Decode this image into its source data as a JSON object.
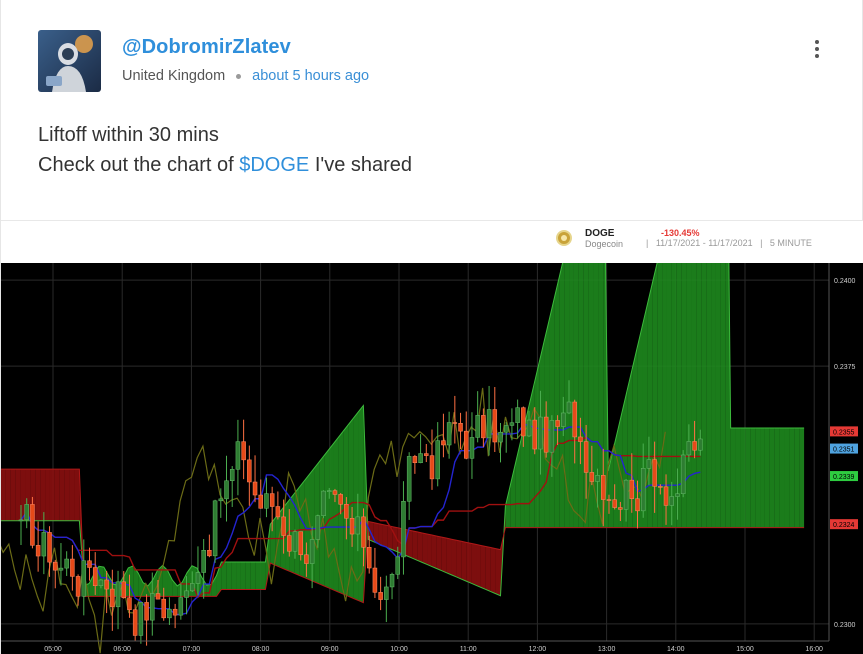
{
  "post": {
    "username": "@DobromirZlatev",
    "location": "United Kingdom",
    "time": "about 5 hours ago",
    "line1": "Liftoff within 30 mins",
    "line2_prefix": "Check out the chart of ",
    "cashtag": "$DOGE",
    "line2_suffix": " I've shared"
  },
  "chart_header": {
    "symbol": "DOGE",
    "name": "Dogecoin",
    "change": "-130.45%",
    "range": "|   11/17/2021 - 11/17/2021   |   5 MINUTE"
  },
  "chart_data": {
    "type": "candlestick",
    "x_ticks": [
      "05:00",
      "06:00",
      "07:00",
      "08:00",
      "09:00",
      "10:00",
      "11:00",
      "12:00",
      "13:00",
      "14:00",
      "15:00",
      "16:00"
    ],
    "y_ticks": [
      "0.2400",
      "0.2375",
      "0.2300"
    ],
    "ylim": [
      0.2295,
      0.2405
    ],
    "price_labels": [
      {
        "text": "0.2355",
        "value": 0.2356,
        "color": "#e53935"
      },
      {
        "text": "0.2351",
        "value": 0.2351,
        "color": "#4fa3e0"
      },
      {
        "text": "0.2339",
        "value": 0.2343,
        "color": "#2ecc40"
      },
      {
        "text": "0.2324",
        "value": 0.2329,
        "color": "#e53935"
      }
    ],
    "colors": {
      "up": "#2e7d32",
      "down": "#e64a19",
      "cloud_bull": "#1e8a1e",
      "cloud_bear": "#8b0f0f"
    }
  }
}
